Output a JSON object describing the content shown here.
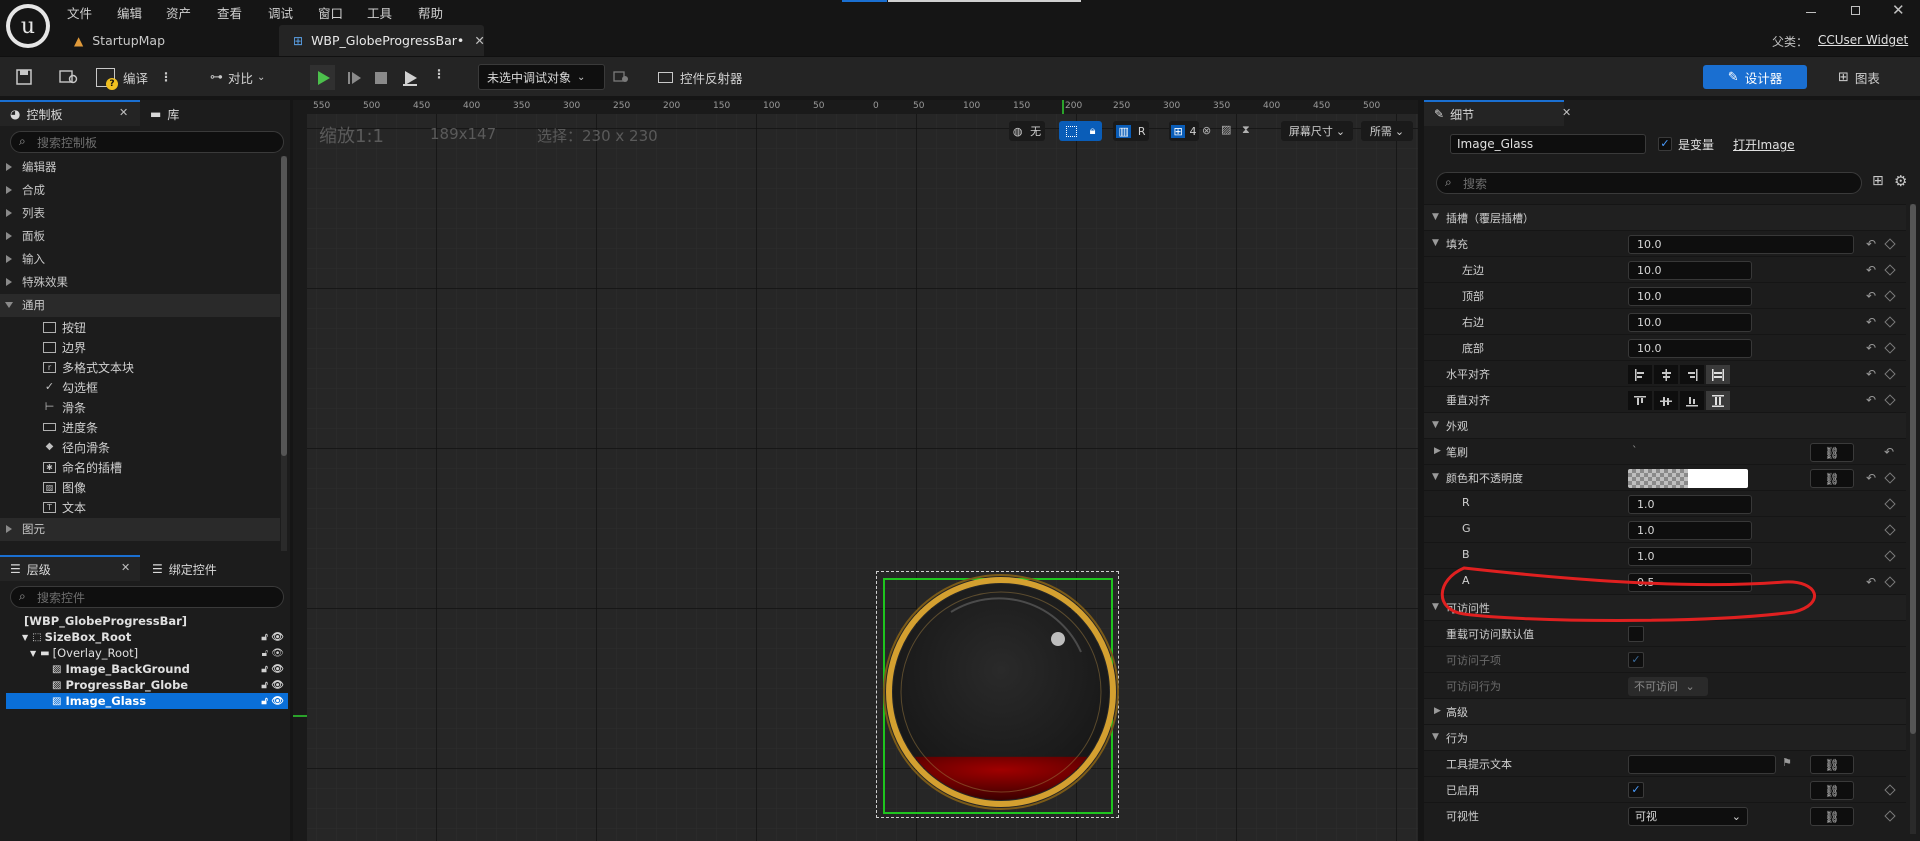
{
  "menu": [
    "文件",
    "编辑",
    "资产",
    "查看",
    "调试",
    "窗口",
    "工具",
    "帮助"
  ],
  "tabs": {
    "map": "StartupMap",
    "widget": "WBP_GlobeProgressBar•"
  },
  "parent": {
    "label": "父类：",
    "value": "CCUser Widget"
  },
  "toolbar": {
    "compile": "编译",
    "diff": "对比",
    "debug_target": "未选中调试对象",
    "reflector": "控件反射器",
    "designer": "设计器",
    "graph": "图表"
  },
  "palette": {
    "tab_palette": "控制板",
    "tab_library": "库",
    "search_placeholder": "搜索控制板",
    "categories": [
      "编辑器",
      "合成",
      "列表",
      "面板",
      "输入",
      "特殊效果",
      "通用"
    ],
    "widgets": [
      "按钮",
      "边界",
      "多格式文本块",
      "勾选框",
      "滑条",
      "进度条",
      "径向滑条",
      "命名的插槽",
      "图像",
      "文本"
    ],
    "widget_icons": [
      "button",
      "border",
      "rich-text",
      "checkbox",
      "slider",
      "progress",
      "radial",
      "named-slot",
      "image",
      "text"
    ],
    "bottom_category": "图元"
  },
  "hierarchy": {
    "tab_hierarchy": "层级",
    "tab_bind": "绑定控件",
    "search_placeholder": "搜索控件",
    "items": [
      "[WBP_GlobeProgressBar]",
      "SizeBox_Root",
      "[Overlay_Root]",
      "Image_BackGround",
      "ProgressBar_Globe",
      "Image_Glass"
    ]
  },
  "viewport": {
    "zoom": "缩放1:1",
    "size": "189x147",
    "selection": "选择：230 x 230",
    "ruler_labels": [
      "550",
      "500",
      "450",
      "400",
      "350",
      "300",
      "250",
      "200",
      "150",
      "100",
      "50",
      "0",
      "50",
      "100",
      "150",
      "200",
      "250",
      "300",
      "350",
      "400",
      "450",
      "500"
    ],
    "btn_none": "无",
    "btn_r": "R",
    "btn_grid": "4",
    "btn_screen": "屏幕尺寸",
    "btn_demand": "所需",
    "globe_fill": 0.2,
    "colors": {
      "selection": "#1ec41e",
      "blue": "#0a5db8",
      "liquid": "#8b0000",
      "gold": "#d4a030"
    }
  },
  "details": {
    "tab": "细节",
    "name": "Image_Glass",
    "is_variable": "是变量",
    "open": "打开Image",
    "search_placeholder": "搜索",
    "slot_section": "插槽（覆层插槽）",
    "padding": "填充",
    "padding_value": "10.0",
    "left": "左边",
    "left_value": "10.0",
    "top": "顶部",
    "top_value": "10.0",
    "right": "右边",
    "right_value": "10.0",
    "bottom": "底部",
    "bottom_value": "10.0",
    "h_align": "水平对齐",
    "v_align": "垂直对齐",
    "appearance": "外观",
    "brush": "笔刷",
    "brush_value": "`",
    "color_opacity": "颜色和不透明度",
    "r": "R",
    "r_value": "1.0",
    "g": "G",
    "g_value": "1.0",
    "b": "B",
    "b_value": "1.0",
    "a": "A",
    "a_value": "0.5",
    "accessibility": "可访问性",
    "override_access": "重载可访问默认值",
    "access_children": "可访问子项",
    "access_behavior": "可访问行为",
    "access_behavior_value": "不可访问",
    "advanced": "高级",
    "behavior": "行为",
    "tooltip": "工具提示文本",
    "enabled": "已启用",
    "visibility": "可视性",
    "visibility_value": "可视"
  }
}
